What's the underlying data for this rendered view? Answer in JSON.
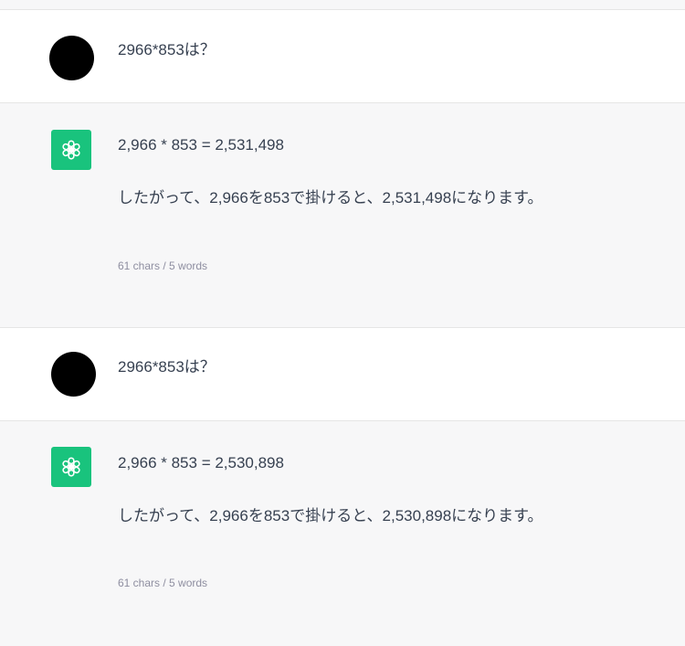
{
  "conversation": {
    "turns": [
      {
        "role": "user",
        "text": "2966*853は？"
      },
      {
        "role": "assistant",
        "answer": "2,966 * 853 = 2,531,498",
        "explanation": "したがって、2,966を853で掛けると、2,531,498になります。",
        "meta": "61 chars / 5 words"
      },
      {
        "role": "user",
        "text": "2966*853は？"
      },
      {
        "role": "assistant",
        "answer": "2,966 * 853 = 2,530,898",
        "explanation": "したがって、2,966を853で掛けると、2,530,898になります。",
        "meta": "61 chars / 5 words"
      }
    ]
  },
  "icons": {
    "assistant_avatar": "openai-logo-icon",
    "user_avatar": "user-avatar"
  },
  "colors": {
    "assistant_avatar_bg": "#19c37d",
    "user_avatar_bg": "#000000",
    "assistant_row_bg": "#f7f7f8",
    "text": "#374151",
    "meta": "#8e8ea0"
  }
}
